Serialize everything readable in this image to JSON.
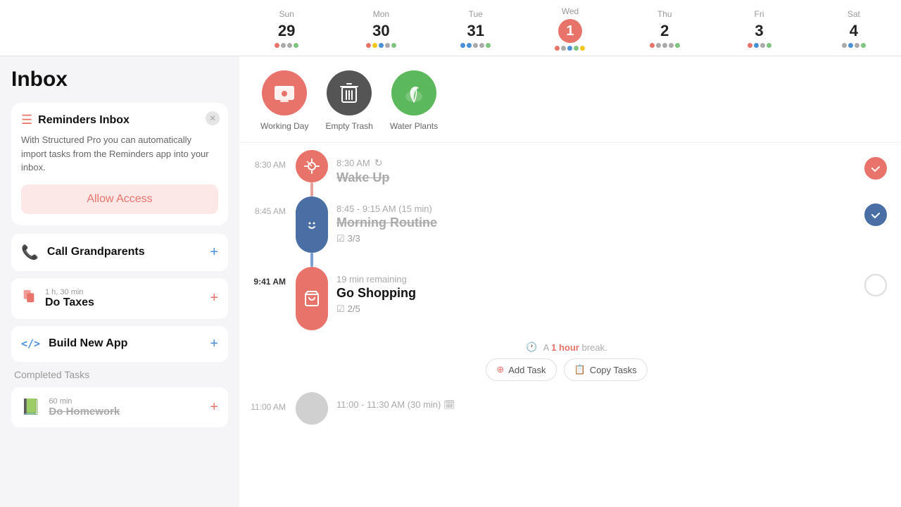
{
  "header": {
    "title": "Inbox"
  },
  "calendar": {
    "days": [
      {
        "name": "Sun",
        "num": "29",
        "today": false,
        "dots": [
          "#e8736a",
          "#aaa",
          "#aaa",
          "#7fc47f"
        ]
      },
      {
        "name": "Mon",
        "num": "30",
        "today": false,
        "dots": [
          "#e8736a",
          "#f5c518",
          "#4a90d9",
          "#aaa",
          "#7fc47f"
        ]
      },
      {
        "name": "Tue",
        "num": "31",
        "today": false,
        "dots": [
          "#4a90d9",
          "#4a90d9",
          "#aaa",
          "#aaa",
          "#7fc47f"
        ]
      },
      {
        "name": "Wed",
        "num": "1",
        "today": true,
        "dots": [
          "#e8736a",
          "#aaa",
          "#4a90d9",
          "#7fc47f",
          "#f5c518"
        ]
      },
      {
        "name": "Thu",
        "num": "2",
        "today": false,
        "dots": [
          "#e8736a",
          "#aaa",
          "#aaa",
          "#aaa",
          "#7fc47f"
        ]
      },
      {
        "name": "Fri",
        "num": "3",
        "today": false,
        "dots": [
          "#e8736a",
          "#4a90d9",
          "#aaa",
          "#7fc47f"
        ]
      },
      {
        "name": "Sat",
        "num": "4",
        "today": false,
        "dots": [
          "#aaa",
          "#4a90d9",
          "#aaa",
          "#7fc47f"
        ]
      }
    ]
  },
  "sidebar": {
    "title": "Inbox",
    "reminders_card": {
      "title": "Reminders Inbox",
      "description": "With Structured Pro you can automatically import tasks from the Reminders app into your inbox.",
      "allow_label": "Allow Access"
    },
    "tasks": [
      {
        "id": "call-grandparents",
        "icon": "📞",
        "icon_color": "blue",
        "name": "Call Grandparents",
        "duration": null
      },
      {
        "id": "do-taxes",
        "icon": "📄",
        "icon_color": "red",
        "name": "Do Taxes",
        "duration": "1 h, 30 min"
      },
      {
        "id": "build-new-app",
        "icon": "</>",
        "icon_color": "blue",
        "name": "Build New App",
        "duration": null
      }
    ],
    "completed_label": "Completed Tasks",
    "completed_tasks": [
      {
        "id": "do-homework",
        "icon": "📗",
        "icon_color": "green",
        "name": "Do Homework",
        "duration": "60 min"
      }
    ]
  },
  "top_icons": [
    {
      "id": "working-day",
      "label": "Working Day",
      "icon": "🖥",
      "color": "pink"
    },
    {
      "id": "empty-trash",
      "label": "Empty Trash",
      "icon": "🗑",
      "color": "gray"
    },
    {
      "id": "water-plants",
      "label": "Water Plants",
      "icon": "🌿",
      "color": "green"
    }
  ],
  "timeline": {
    "items": [
      {
        "id": "wake-up",
        "time_label": "8:30 AM",
        "time_bold": false,
        "title": "Wake Up",
        "strikethrough": true,
        "time_display": "8:30 AM",
        "subtitle": null,
        "bubble_color": "pink",
        "bubble_icon": "⏰",
        "checked": true,
        "check_type": "pink",
        "has_recur": true
      },
      {
        "id": "morning-routine",
        "time_label": "8:45 AM",
        "time_bold": false,
        "title": "Morning Routine",
        "strikethrough": true,
        "time_display": "8:45 - 9:15 AM (15 min)",
        "subtitle": "3/3",
        "bubble_color": "darkblue",
        "bubble_icon": "😊",
        "checked": true,
        "check_type": "blue"
      },
      {
        "id": "go-shopping",
        "time_label": "9:41 AM",
        "time_bold": true,
        "title": "Go Shopping",
        "strikethrough": false,
        "time_display": "19 min remaining",
        "subtitle": "2/5",
        "bubble_color": "pink",
        "bubble_icon": "🛒",
        "checked": false,
        "check_type": "none"
      }
    ],
    "break": {
      "text": "A",
      "accent": "1 hour",
      "suffix": "break.",
      "add_label": "Add Task",
      "copy_label": "Copy Tasks"
    },
    "bottom_item": {
      "time_label": "11:00 AM",
      "time_display": "11:00 - 11:30 AM (30 min)",
      "title": "...",
      "bubble_color": "gray"
    }
  }
}
